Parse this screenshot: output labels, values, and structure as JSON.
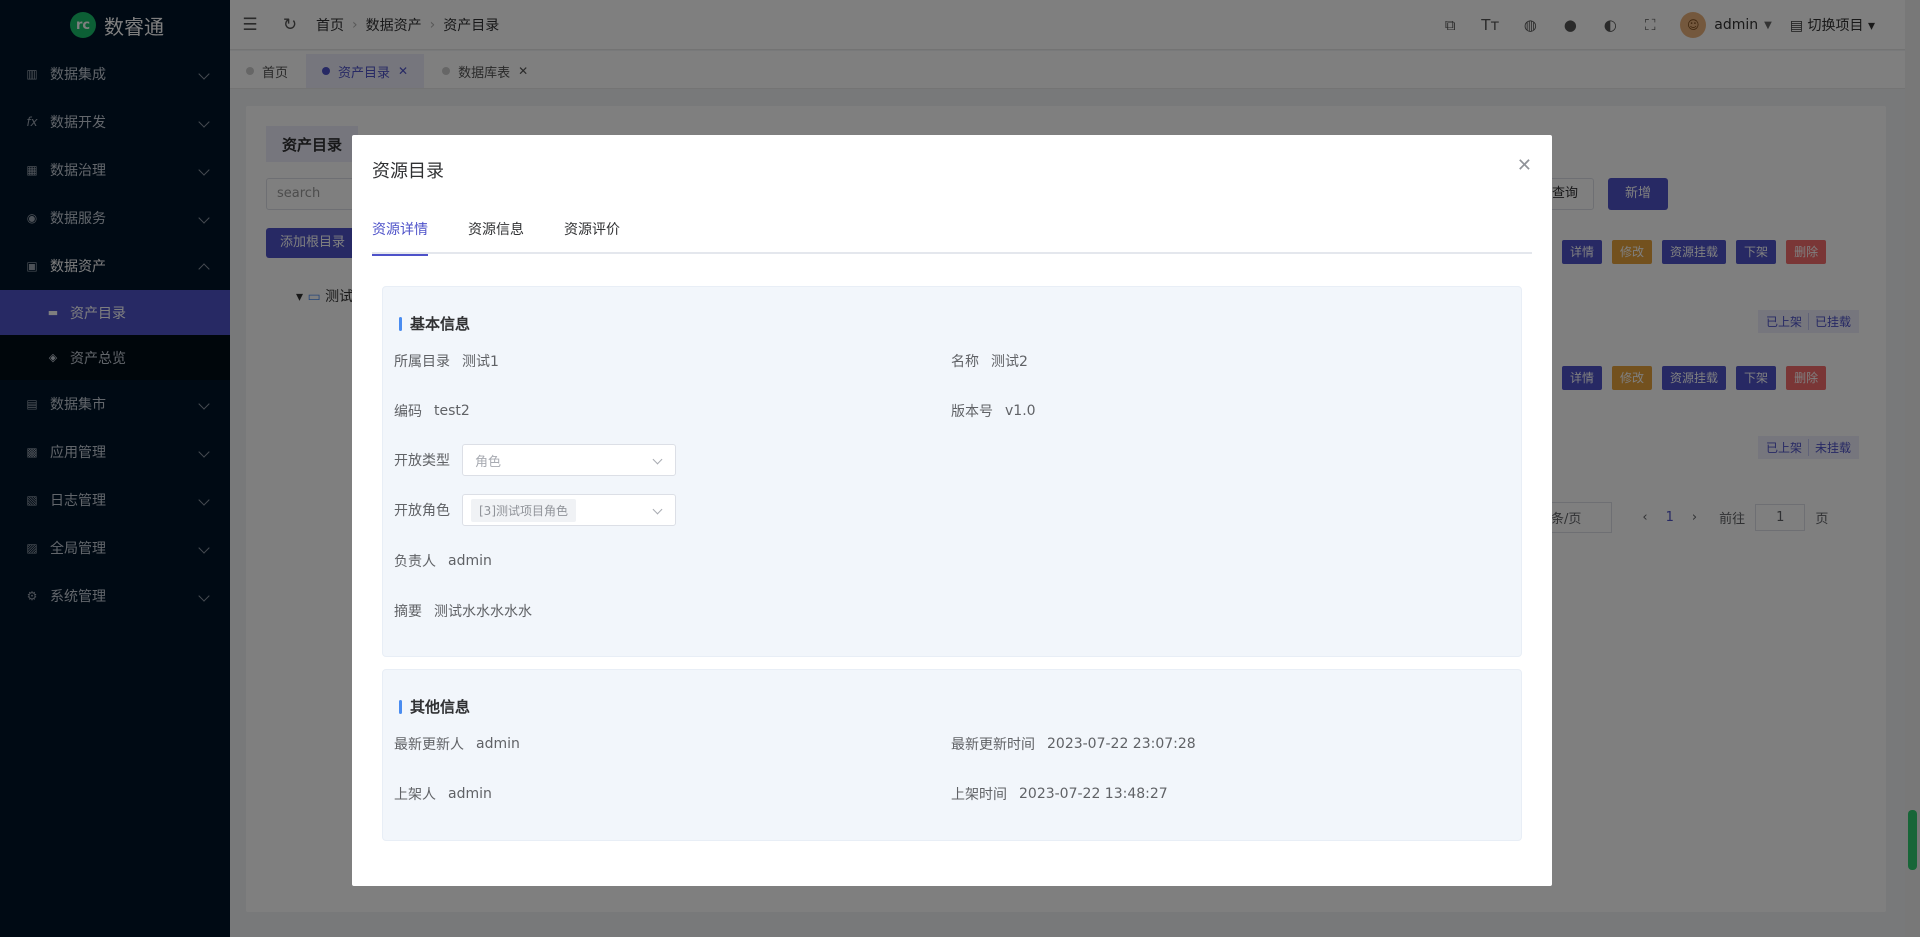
{
  "app": {
    "name": "数睿通",
    "logo_glyph": "rc"
  },
  "sidebar": {
    "items": [
      {
        "label": "数据集成",
        "icon": "integration-icon"
      },
      {
        "label": "数据开发",
        "icon": "fx-icon",
        "glyph": "fx"
      },
      {
        "label": "数据治理",
        "icon": "table-icon"
      },
      {
        "label": "数据服务",
        "icon": "service-icon"
      },
      {
        "label": "数据资产",
        "icon": "asset-icon",
        "open": true
      },
      {
        "label": "数据集市",
        "icon": "market-icon"
      },
      {
        "label": "应用管理",
        "icon": "app-icon"
      },
      {
        "label": "日志管理",
        "icon": "log-icon"
      },
      {
        "label": "全局管理",
        "icon": "global-icon"
      },
      {
        "label": "系统管理",
        "icon": "system-icon"
      }
    ],
    "sub_items": [
      {
        "label": "资产目录",
        "active": true
      },
      {
        "label": "资产总览",
        "active": false
      }
    ]
  },
  "header": {
    "breadcrumb": [
      "首页",
      "数据资产",
      "资产目录"
    ],
    "user": "admin",
    "switch_label": "切换项目"
  },
  "tabs_bar": [
    {
      "label": "首页",
      "active": false,
      "closable": false
    },
    {
      "label": "资产目录",
      "active": true,
      "closable": true
    },
    {
      "label": "数据库表",
      "active": false,
      "closable": true
    }
  ],
  "background": {
    "title": "资产目录",
    "search_placeholder": "search",
    "add_button": "添加根目录",
    "tree_root": "测试",
    "query": "查询",
    "new": "新增",
    "row_buttons": [
      "详情",
      "修改",
      "资源挂载",
      "下架",
      "删除"
    ],
    "row1_tags": [
      "已上架",
      "已挂载"
    ],
    "row2_tags": [
      "已上架",
      "未挂载"
    ],
    "pager": {
      "size": "条/页",
      "current": "1",
      "goto": "前往",
      "page_value": "1",
      "page_unit": "页"
    }
  },
  "modal": {
    "title": "资源目录",
    "tabs": [
      "资源详情",
      "资源信息",
      "资源评价"
    ],
    "basic": {
      "title": "基本信息",
      "catalog_label": "所属目录",
      "catalog": "测试1",
      "name_label": "名称",
      "name": "测试2",
      "code_label": "编码",
      "code": "test2",
      "version_label": "版本号",
      "version": "v1.0",
      "open_type_label": "开放类型",
      "open_type_placeholder": "角色",
      "open_role_label": "开放角色",
      "open_role": "[3]测试项目角色",
      "owner_label": "负责人",
      "owner": "admin",
      "summary_label": "摘要",
      "summary": "测试水水水水水"
    },
    "other": {
      "title": "其他信息",
      "updater_label": "最新更新人",
      "updater": "admin",
      "update_time_label": "最新更新时间",
      "update_time": "2023-07-22 23:07:28",
      "publisher_label": "上架人",
      "publisher": "admin",
      "publish_time_label": "上架时间",
      "publish_time": "2023-07-22 13:48:27"
    }
  },
  "colors": {
    "primary": "#4e52c9",
    "sidebar": "#001529",
    "orange": "#e6a23c",
    "red": "#f56c6c"
  }
}
